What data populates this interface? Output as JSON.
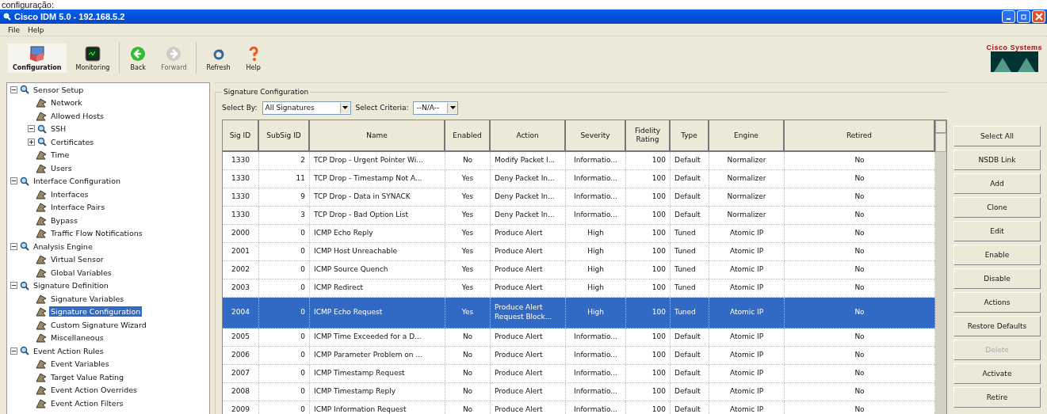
{
  "caption": "configuração:",
  "window": {
    "title": "Cisco IDM 5.0 - 192.168.5.2"
  },
  "menu": [
    "File",
    "Help"
  ],
  "toolbar": [
    {
      "label": "Configuration",
      "kind": "config",
      "selected": true,
      "disabled": false
    },
    {
      "label": "Monitoring",
      "kind": "monitor",
      "selected": false,
      "disabled": false
    },
    {
      "label": "Back",
      "kind": "back",
      "selected": false,
      "disabled": false
    },
    {
      "label": "Forward",
      "kind": "forward",
      "selected": false,
      "disabled": true
    },
    {
      "label": "Refresh",
      "kind": "refresh",
      "selected": false,
      "disabled": false
    },
    {
      "label": "Help",
      "kind": "help",
      "selected": false,
      "disabled": false
    }
  ],
  "logo": "Cisco Systems",
  "tree": [
    {
      "label": "Sensor Setup",
      "kind": "folder",
      "expanded": true,
      "selected": false,
      "children": [
        {
          "label": "Network",
          "kind": "leaf",
          "selected": false
        },
        {
          "label": "Allowed Hosts",
          "kind": "leaf",
          "selected": false
        },
        {
          "label": "SSH",
          "kind": "folder",
          "expanded": true,
          "selected": false
        },
        {
          "label": "Certificates",
          "kind": "folder",
          "expanded": false,
          "selected": false
        },
        {
          "label": "Time",
          "kind": "leaf",
          "selected": false
        },
        {
          "label": "Users",
          "kind": "leaf",
          "selected": false
        }
      ]
    },
    {
      "label": "Interface Configuration",
      "kind": "folder",
      "expanded": true,
      "selected": false,
      "children": [
        {
          "label": "Interfaces",
          "kind": "leaf",
          "selected": false
        },
        {
          "label": "Interface Pairs",
          "kind": "leaf",
          "selected": false
        },
        {
          "label": "Bypass",
          "kind": "leaf",
          "selected": false
        },
        {
          "label": "Traffic Flow Notifications",
          "kind": "leaf",
          "selected": false
        }
      ]
    },
    {
      "label": "Analysis Engine",
      "kind": "folder",
      "expanded": true,
      "selected": false,
      "children": [
        {
          "label": "Virtual Sensor",
          "kind": "leaf",
          "selected": false
        },
        {
          "label": "Global Variables",
          "kind": "leaf",
          "selected": false
        }
      ]
    },
    {
      "label": "Signature Definition",
      "kind": "folder",
      "expanded": true,
      "selected": false,
      "children": [
        {
          "label": "Signature Variables",
          "kind": "leaf",
          "selected": false
        },
        {
          "label": "Signature Configuration",
          "kind": "leaf",
          "selected": true
        },
        {
          "label": "Custom Signature Wizard",
          "kind": "leaf",
          "selected": false
        },
        {
          "label": "Miscellaneous",
          "kind": "leaf",
          "selected": false
        }
      ]
    },
    {
      "label": "Event Action Rules",
      "kind": "folder",
      "expanded": true,
      "selected": false,
      "children": [
        {
          "label": "Event Variables",
          "kind": "leaf",
          "selected": false
        },
        {
          "label": "Target Value Rating",
          "kind": "leaf",
          "selected": false
        },
        {
          "label": "Event Action Overrides",
          "kind": "leaf",
          "selected": false
        },
        {
          "label": "Event Action Filters",
          "kind": "leaf",
          "selected": false
        }
      ]
    }
  ],
  "panel": {
    "title": "Signature Configuration",
    "select_by": {
      "label": "Select By:",
      "value": "All Signatures"
    },
    "select_criteria": {
      "label": "Select Criteria:",
      "value": "--N/A--"
    },
    "table": {
      "columns": [
        "Sig ID",
        "SubSig ID",
        "Name",
        "Enabled",
        "Action",
        "Severity",
        "Fidelity Rating",
        "Type",
        "Engine",
        "Retired"
      ],
      "rows": [
        {
          "selected": false,
          "cells": [
            "1330",
            "2",
            "TCP Drop - Urgent Pointer Wi...",
            "No",
            "Modify Packet I...",
            "Informatio...",
            "100",
            "Default",
            "Normalizer",
            "No"
          ]
        },
        {
          "selected": false,
          "cells": [
            "1330",
            "11",
            "TCP Drop - Timestamp Not A...",
            "Yes",
            "Deny Packet In...",
            "Informatio...",
            "100",
            "Default",
            "Normalizer",
            "No"
          ]
        },
        {
          "selected": false,
          "cells": [
            "1330",
            "9",
            "TCP Drop - Data in SYNACK",
            "Yes",
            "Deny Packet In...",
            "Informatio...",
            "100",
            "Default",
            "Normalizer",
            "No"
          ]
        },
        {
          "selected": false,
          "cells": [
            "1330",
            "3",
            "TCP Drop - Bad Option List",
            "Yes",
            "Deny Packet In...",
            "Informatio...",
            "100",
            "Default",
            "Normalizer",
            "No"
          ]
        },
        {
          "selected": false,
          "cells": [
            "2000",
            "0",
            "ICMP Echo Reply",
            "Yes",
            "Produce Alert",
            "High",
            "100",
            "Tuned",
            "Atomic IP",
            "No"
          ]
        },
        {
          "selected": false,
          "cells": [
            "2001",
            "0",
            "ICMP Host Unreachable",
            "Yes",
            "Produce Alert",
            "High",
            "100",
            "Tuned",
            "Atomic IP",
            "No"
          ]
        },
        {
          "selected": false,
          "cells": [
            "2002",
            "0",
            "ICMP Source Quench",
            "Yes",
            "Produce Alert",
            "High",
            "100",
            "Tuned",
            "Atomic IP",
            "No"
          ]
        },
        {
          "selected": false,
          "cells": [
            "2003",
            "0",
            "ICMP Redirect",
            "Yes",
            "Produce Alert",
            "High",
            "100",
            "Tuned",
            "Atomic IP",
            "No"
          ]
        },
        {
          "selected": true,
          "cells": [
            "2004",
            "0",
            "ICMP Echo Request",
            "Yes",
            "Produce Alert Request Block...",
            "High",
            "100",
            "Tuned",
            "Atomic IP",
            "No"
          ]
        },
        {
          "selected": false,
          "cells": [
            "2005",
            "0",
            "ICMP Time Exceeded for a D...",
            "No",
            "Produce Alert",
            "Informatio...",
            "100",
            "Default",
            "Atomic IP",
            "No"
          ]
        },
        {
          "selected": false,
          "cells": [
            "2006",
            "0",
            "ICMP Parameter Problem on ...",
            "No",
            "Produce Alert",
            "Informatio...",
            "100",
            "Default",
            "Atomic IP",
            "No"
          ]
        },
        {
          "selected": false,
          "cells": [
            "2007",
            "0",
            "ICMP Timestamp Request",
            "No",
            "Produce Alert",
            "Informatio...",
            "100",
            "Default",
            "Atomic IP",
            "No"
          ]
        },
        {
          "selected": false,
          "cells": [
            "2008",
            "0",
            "ICMP Timestamp Reply",
            "No",
            "Produce Alert",
            "Informatio...",
            "100",
            "Default",
            "Atomic IP",
            "No"
          ]
        },
        {
          "selected": false,
          "cells": [
            "2009",
            "0",
            "ICMP Information Request",
            "No",
            "Produce Alert",
            "Informatio...",
            "100",
            "Default",
            "Atomic IP",
            "No"
          ]
        }
      ]
    },
    "buttons": [
      {
        "label": "Select All",
        "disabled": false
      },
      {
        "label": "NSDB Link",
        "disabled": false
      },
      {
        "label": "Add",
        "disabled": false
      },
      {
        "label": "Clone",
        "disabled": false
      },
      {
        "label": "Edit",
        "disabled": false
      },
      {
        "label": "Enable",
        "disabled": false
      },
      {
        "label": "Disable",
        "disabled": false
      },
      {
        "label": "Actions",
        "disabled": false
      },
      {
        "label": "Restore Defaults",
        "disabled": false
      },
      {
        "label": "Delete",
        "disabled": true
      },
      {
        "label": "Activate",
        "disabled": false
      },
      {
        "label": "Retire",
        "disabled": false
      }
    ]
  }
}
